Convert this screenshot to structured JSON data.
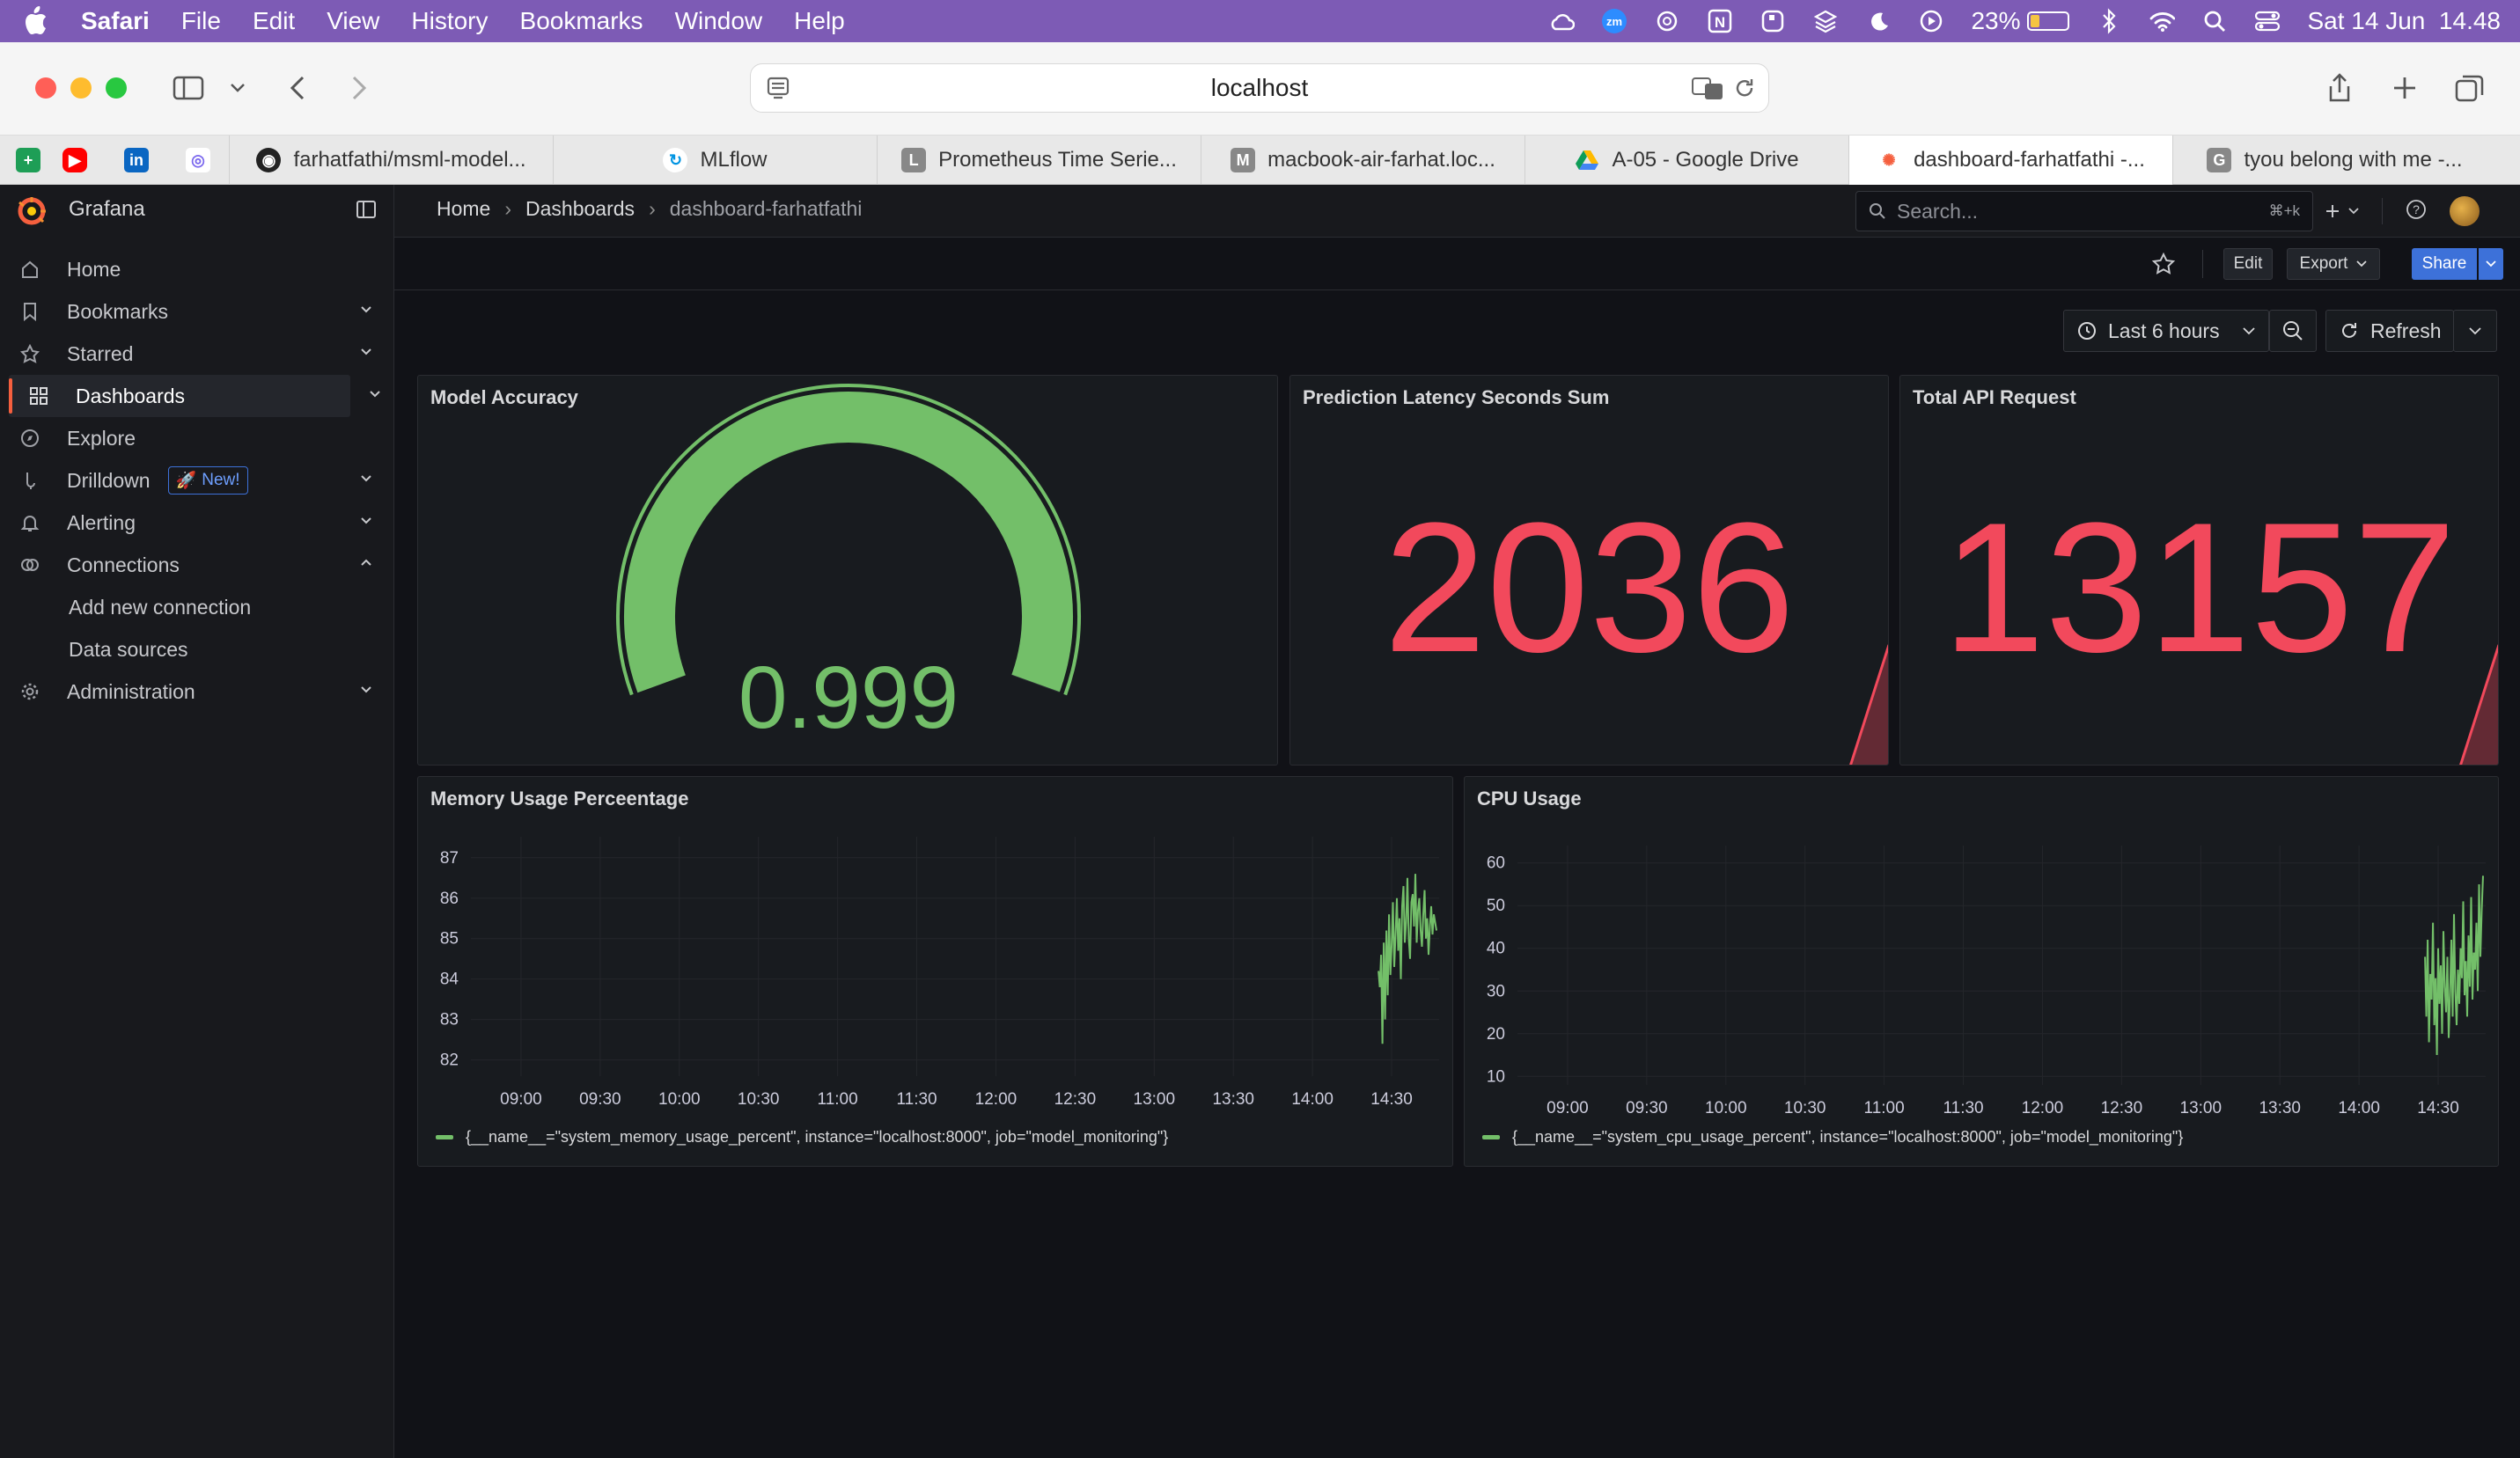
{
  "menubar": {
    "app": "Safari",
    "items": [
      "File",
      "Edit",
      "View",
      "History",
      "Bookmarks",
      "Window",
      "Help"
    ],
    "battery": "23%",
    "datetime": "Sat 14 Jun  14.48"
  },
  "browser": {
    "address": "localhost",
    "tabs": [
      {
        "label": "farhatfathi/msml-model...",
        "icon": "github-icon"
      },
      {
        "label": "MLflow",
        "icon": "mlflow-icon"
      },
      {
        "label": "Prometheus Time Serie...",
        "icon": "prometheus-icon",
        "letter": "L"
      },
      {
        "label": "macbook-air-farhat.loc...",
        "icon": "m-icon",
        "letter": "M"
      },
      {
        "label": "A-05 - Google Drive",
        "icon": "google-drive-icon"
      },
      {
        "label": "dashboard-farhatfathi -...",
        "icon": "grafana-icon"
      },
      {
        "label": "tyou belong with me -...",
        "icon": "g-icon",
        "letter": "G"
      }
    ]
  },
  "grafana": {
    "brand": "Grafana",
    "search_placeholder": "Search...",
    "search_shortcut": "⌘+k",
    "breadcrumb": [
      "Home",
      "Dashboards",
      "dashboard-farhatfathi"
    ],
    "nav": [
      {
        "label": "Home",
        "icon": "home-icon"
      },
      {
        "label": "Bookmarks",
        "icon": "bookmark-icon"
      },
      {
        "label": "Starred",
        "icon": "star-icon"
      },
      {
        "label": "Dashboards",
        "icon": "dashboards-icon"
      },
      {
        "label": "Explore",
        "icon": "compass-icon"
      },
      {
        "label": "Drilldown",
        "icon": "drilldown-icon",
        "badge": "New!"
      },
      {
        "label": "Alerting",
        "icon": "bell-icon"
      },
      {
        "label": "Connections",
        "icon": "connections-icon"
      },
      {
        "label": "Add new connection"
      },
      {
        "label": "Data sources"
      },
      {
        "label": "Administration",
        "icon": "gear-icon"
      }
    ],
    "toolbar": {
      "edit": "Edit",
      "export": "Export",
      "share": "Share"
    },
    "time_range": "Last 6 hours",
    "refresh": "Refresh",
    "colors": {
      "accent": "#3d71d9",
      "green": "#73bf69",
      "red": "#f2495c",
      "grafana_orange": "#f55f3e"
    }
  },
  "panels": {
    "accuracy": {
      "title": "Model Accuracy",
      "value": "0.999",
      "fraction": 0.999
    },
    "latency": {
      "title": "Prediction Latency Seconds Sum",
      "value": "2036"
    },
    "requests": {
      "title": "Total API Request",
      "value": "13157"
    },
    "memory": {
      "title": "Memory Usage Perceentage",
      "legend": "{__name__=\"system_memory_usage_percent\", instance=\"localhost:8000\", job=\"model_monitoring\"}"
    },
    "cpu": {
      "title": "CPU Usage",
      "legend": "{__name__=\"system_cpu_usage_percent\", instance=\"localhost:8000\", job=\"model_monitoring\"}"
    }
  },
  "chart_data": [
    {
      "type": "line",
      "title": "Memory Usage Perceentage",
      "x_ticks": [
        "09:00",
        "09:30",
        "10:00",
        "10:30",
        "11:00",
        "11:30",
        "12:00",
        "12:30",
        "13:00",
        "13:30",
        "14:00",
        "14:30"
      ],
      "y_ticks": [
        82,
        83,
        84,
        85,
        86,
        87
      ],
      "ylim": [
        81.6,
        87.3
      ],
      "xlim": [
        "08:41",
        "14:48"
      ],
      "series": [
        {
          "color": "#73bf69",
          "x": [
            "14:25",
            "14:25.5",
            "14:26",
            "14:26.5",
            "14:27",
            "14:27.5",
            "14:28",
            "14:28.5",
            "14:29",
            "14:29.5",
            "14:30",
            "14:30.5",
            "14:31",
            "14:31.5",
            "14:32",
            "14:32.5",
            "14:33",
            "14:33.5",
            "14:34",
            "14:34.5",
            "14:35",
            "14:35.5",
            "14:36",
            "14:36.5",
            "14:37",
            "14:37.5",
            "14:38",
            "14:38.5",
            "14:39",
            "14:39.5",
            "14:40",
            "14:40.5",
            "14:41",
            "14:41.5",
            "14:42",
            "14:42.5",
            "14:43",
            "14:43.5",
            "14:44",
            "14:44.5",
            "14:45",
            "14:45.5",
            "14:46",
            "14:46.5",
            "14:47"
          ],
          "values": [
            84.2,
            83.8,
            84.6,
            82.4,
            84.9,
            83.0,
            85.2,
            83.6,
            85.6,
            84.1,
            84.8,
            85.9,
            84.3,
            85.1,
            86.0,
            84.7,
            85.5,
            84.0,
            85.8,
            86.3,
            84.9,
            85.4,
            86.5,
            85.0,
            84.5,
            85.9,
            86.1,
            85.3,
            86.6,
            84.9,
            85.7,
            86.0,
            85.2,
            84.8,
            85.6,
            86.2,
            85.0,
            85.5,
            84.6,
            85.3,
            85.8,
            85.1,
            85.6,
            85.4,
            85.2
          ]
        }
      ]
    },
    {
      "type": "line",
      "title": "CPU Usage",
      "x_ticks": [
        "09:00",
        "09:30",
        "10:00",
        "10:30",
        "11:00",
        "11:30",
        "12:00",
        "12:30",
        "13:00",
        "13:30",
        "14:00",
        "14:30"
      ],
      "y_ticks": [
        10,
        20,
        30,
        40,
        50,
        60
      ],
      "ylim": [
        8,
        62
      ],
      "xlim": [
        "08:41",
        "14:48"
      ],
      "series": [
        {
          "color": "#73bf69",
          "x": [
            "14:25",
            "14:25.5",
            "14:26",
            "14:26.5",
            "14:27",
            "14:27.5",
            "14:28",
            "14:28.5",
            "14:29",
            "14:29.5",
            "14:30",
            "14:30.5",
            "14:31",
            "14:31.5",
            "14:32",
            "14:32.5",
            "14:33",
            "14:33.5",
            "14:34",
            "14:34.5",
            "14:35",
            "14:35.5",
            "14:36",
            "14:36.5",
            "14:37",
            "14:37.5",
            "14:38",
            "14:38.5",
            "14:39",
            "14:39.5",
            "14:40",
            "14:40.5",
            "14:41",
            "14:41.5",
            "14:42",
            "14:42.5",
            "14:43",
            "14:43.5",
            "14:44",
            "14:44.5",
            "14:45",
            "14:45.5",
            "14:46",
            "14:46.5",
            "14:47"
          ],
          "values": [
            38,
            24,
            42,
            18,
            34,
            28,
            46,
            22,
            33,
            15,
            40,
            27,
            36,
            20,
            44,
            31,
            25,
            38,
            19,
            29,
            42,
            24,
            48,
            30,
            22,
            35,
            27,
            40,
            33,
            51,
            29,
            37,
            24,
            43,
            31,
            52,
            28,
            39,
            35,
            46,
            30,
            55,
            38,
            49,
            57
          ]
        }
      ]
    }
  ]
}
